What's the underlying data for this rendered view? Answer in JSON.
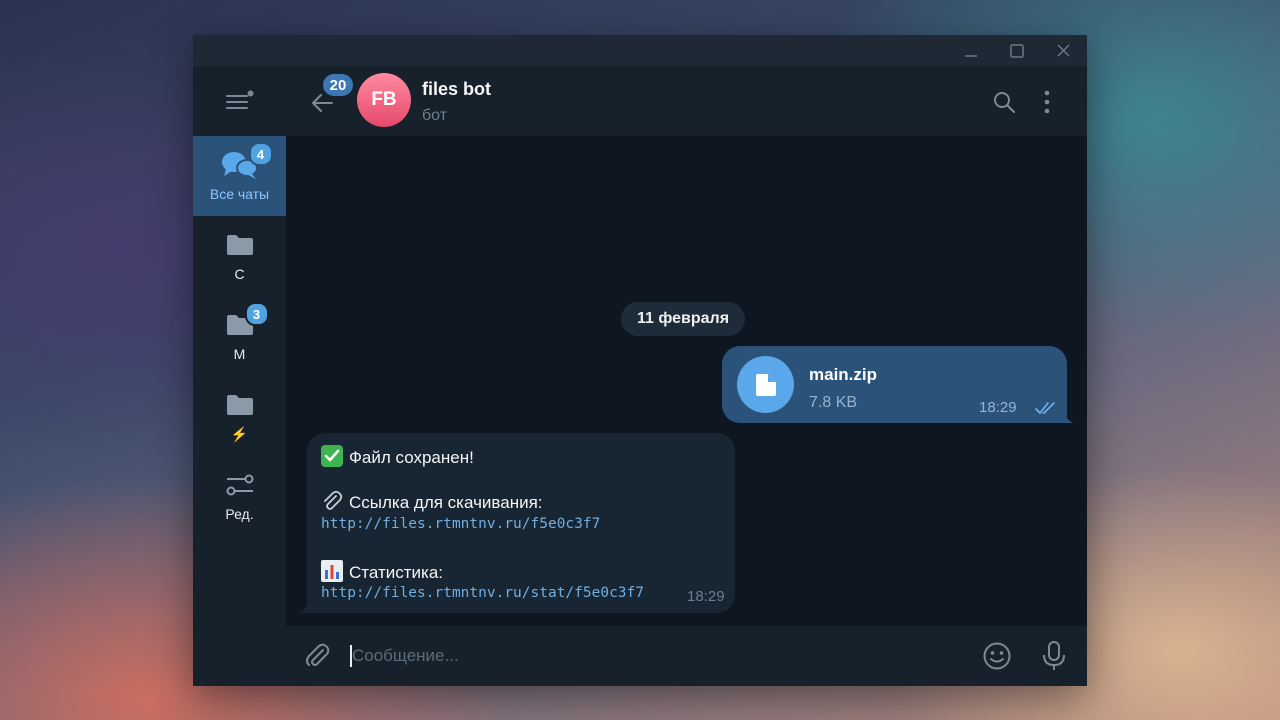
{
  "window": {
    "controls": [
      "minimize",
      "maximize",
      "close"
    ]
  },
  "sidebar": {
    "menu_icon": "hamburger-menu-icon",
    "folders": [
      {
        "label": "Все чаты",
        "badge": "4",
        "icon": "chats-icon",
        "active": true
      },
      {
        "label": "С",
        "badge": "",
        "icon": "folder-icon",
        "active": false
      },
      {
        "label": "М",
        "badge": "3",
        "icon": "folder-icon",
        "active": false
      },
      {
        "label": "⚡",
        "badge": "",
        "icon": "folder-icon",
        "active": false
      },
      {
        "label": "Ред.",
        "badge": "",
        "icon": "sliders-icon",
        "active": false
      }
    ]
  },
  "header": {
    "back_badge": "20",
    "avatar_initials": "FB",
    "title": "files bot",
    "status": "бот"
  },
  "chat": {
    "date_label": "11 февраля",
    "outgoing": {
      "file_name": "main.zip",
      "file_size": "7.8 KB",
      "time": "18:29",
      "status": "read"
    },
    "incoming": {
      "saved_text": "Файл сохранен!",
      "download_label": "Ссылка для скачивания:",
      "download_link": "http://files.rtmntnv.ru/f5e0c3f7",
      "stats_label": "Статистика:",
      "stats_link": "http://files.rtmntnv.ru/stat/f5e0c3f7",
      "time": "18:29"
    }
  },
  "composer": {
    "placeholder": "Сообщение...",
    "value": ""
  },
  "colors": {
    "accent": "#4fa3e0",
    "active_folder_bg": "#2b5278",
    "outgoing_bubble": "#2b5278",
    "incoming_bubble": "#182533",
    "link": "#71aee0",
    "avatar": "#e5496c"
  }
}
